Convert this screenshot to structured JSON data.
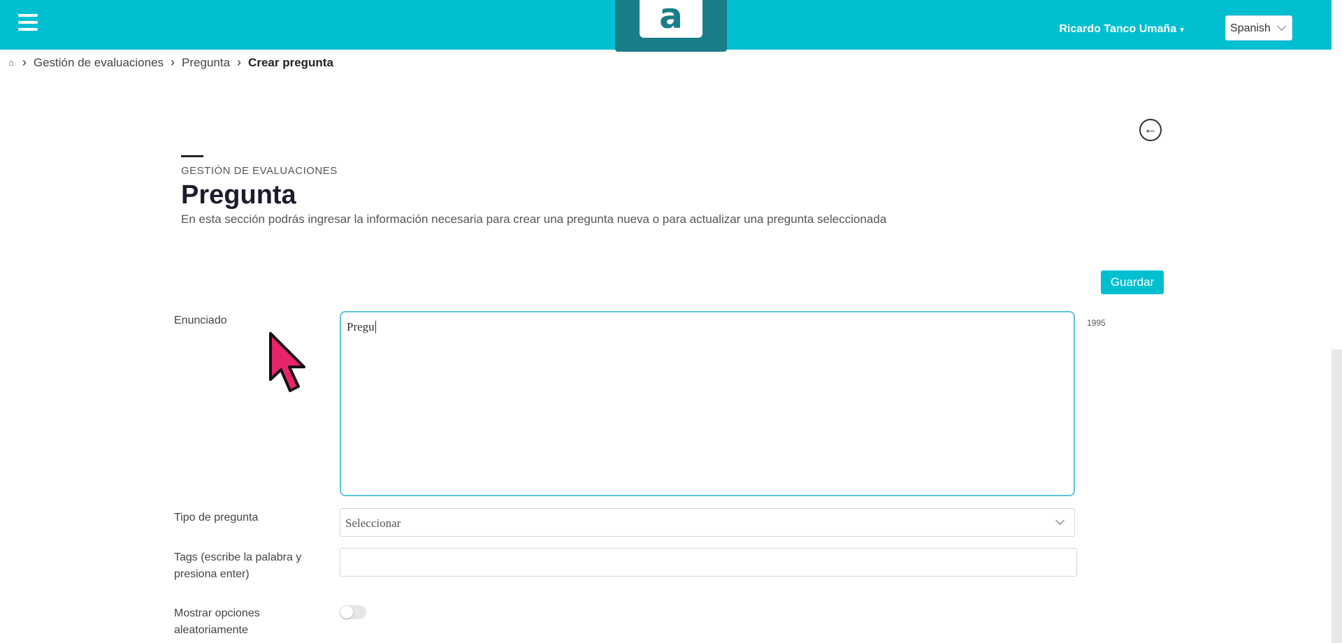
{
  "topbar": {
    "logo_letter": "a",
    "user_name": "Ricardo Tanco Umaña",
    "language": "Spanish",
    "accent_color": "#00bfd1"
  },
  "breadcrumb": {
    "items": [
      "Gestión de evaluaciones",
      "Pregunta",
      "Crear pregunta"
    ]
  },
  "header": {
    "section_label": "GESTIÓN DE EVALUACIONES",
    "title": "Pregunta",
    "description": "En esta sección podrás ingresar la información necesaria para crear una pregunta nueva o para actualizar una pregunta seleccionada"
  },
  "actions": {
    "save_label": "Guardar"
  },
  "form": {
    "statement_label": "Enunciado",
    "statement_value": "Pregu",
    "char_count": "1995",
    "type_label": "Tipo de pregunta",
    "type_value": "Seleccionar",
    "tags_label_line1": "Tags (escribe la palabra y",
    "tags_label_line2": "presiona enter)",
    "tags_value": "",
    "random_label_line1": "Mostrar opciones",
    "random_label_line2": "aleatoriamente",
    "random_enabled": false
  }
}
